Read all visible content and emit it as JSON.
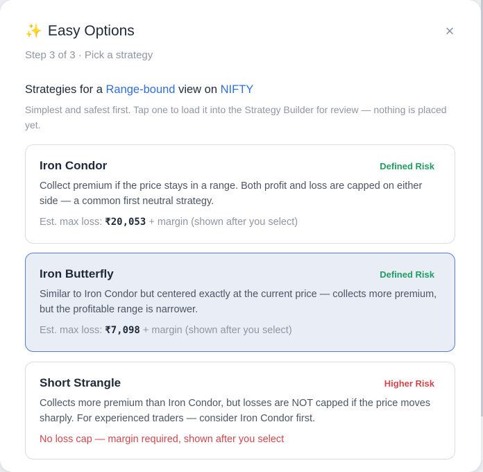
{
  "modal": {
    "icon": "sparkles-icon",
    "title": "Easy Options",
    "close_label": "×",
    "step": "Step 3 of 3 · Pick a strategy"
  },
  "intro": {
    "prefix": "Strategies for a ",
    "view": "Range-bound",
    "middle": " view on ",
    "symbol": "NIFTY",
    "subtitle": "Simplest and safest first. Tap one to load it into the Strategy Builder for review — nothing is placed yet."
  },
  "strategies": [
    {
      "name": "Iron Condor",
      "risk": "Defined Risk",
      "risk_color": "#1f9d63",
      "description": "Collect premium if the price stays in a range. Both profit and loss are capped on either side — a common first neutral strategy.",
      "loss_prefix": "Est. max loss: ",
      "loss_amount": "₹20,053",
      "loss_suffix": " + margin (shown after you select)",
      "selected": false
    },
    {
      "name": "Iron Butterfly",
      "risk": "Defined Risk",
      "risk_color": "#1f9d63",
      "description": "Similar to Iron Condor but centered exactly at the current price — collects more premium, but the profitable range is narrower.",
      "loss_prefix": "Est. max loss: ",
      "loss_amount": "₹7,098",
      "loss_suffix": " + margin (shown after you select)",
      "selected": true
    },
    {
      "name": "Short Strangle",
      "risk": "Higher Risk",
      "risk_color": "#d0464c",
      "description": "Collects more premium than Iron Condor, but losses are NOT capped if the price moves sharply. For experienced traders — consider Iron Condor first.",
      "warning": "No loss cap — margin required, shown after you select",
      "selected": false
    }
  ]
}
